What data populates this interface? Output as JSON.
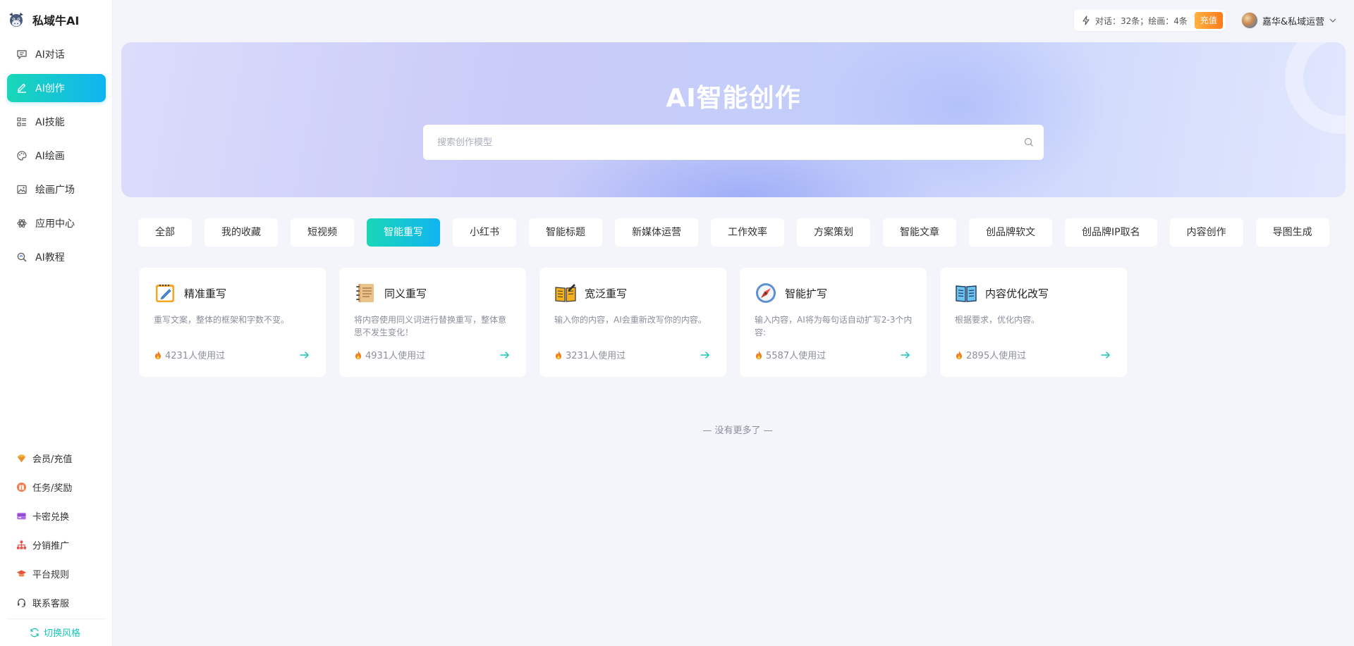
{
  "brand": {
    "name": "私域牛AI"
  },
  "nav": {
    "items": [
      {
        "label": "AI对话",
        "icon": "chat-icon"
      },
      {
        "label": "AI创作",
        "icon": "pen-icon",
        "active": true
      },
      {
        "label": "AI技能",
        "icon": "list-icon"
      },
      {
        "label": "AI绘画",
        "icon": "palette-icon"
      },
      {
        "label": "绘画广场",
        "icon": "image-icon"
      },
      {
        "label": "应用中心",
        "icon": "apps-icon"
      },
      {
        "label": "AI教程",
        "icon": "tutorial-icon"
      }
    ]
  },
  "bottom_nav": {
    "items": [
      {
        "label": "会员/充值",
        "icon": "diamond-icon"
      },
      {
        "label": "任务/奖励",
        "icon": "gift-icon"
      },
      {
        "label": "卡密兑换",
        "icon": "card-icon"
      },
      {
        "label": "分销推广",
        "icon": "network-icon"
      },
      {
        "label": "平台规则",
        "icon": "graduation-icon"
      },
      {
        "label": "联系客服",
        "icon": "headset-icon"
      }
    ],
    "switch_style": "切换风格"
  },
  "header": {
    "quota_text": "对话：32条；绘画：4条",
    "recharge_label": "充值",
    "user_name": "嘉华&私域运营"
  },
  "hero": {
    "title": "AI智能创作",
    "search_placeholder": "搜索创作模型"
  },
  "tabs": [
    {
      "label": "全部"
    },
    {
      "label": "我的收藏"
    },
    {
      "label": "短视频"
    },
    {
      "label": "智能重写",
      "active": true
    },
    {
      "label": "小红书"
    },
    {
      "label": "智能标题"
    },
    {
      "label": "新媒体运营"
    },
    {
      "label": "工作效率"
    },
    {
      "label": "方案策划"
    },
    {
      "label": "智能文章"
    },
    {
      "label": "创品牌软文"
    },
    {
      "label": "创品牌IP取名"
    },
    {
      "label": "内容创作"
    },
    {
      "label": "导图生成"
    }
  ],
  "cards": [
    {
      "title": "精准重写",
      "desc": "重写文案，整体的框架和字数不变。",
      "usage": "4231人使用过",
      "icon": "notepad-icon"
    },
    {
      "title": "同义重写",
      "desc": "将内容使用同义词进行替换重写，整体意思不发生变化！",
      "usage": "4931人使用过",
      "icon": "notebook-icon"
    },
    {
      "title": "宽泛重写",
      "desc": "输入你的内容，AI会重新改写你的内容。",
      "usage": "3231人使用过",
      "icon": "book-icon"
    },
    {
      "title": "智能扩写",
      "desc": "输入内容，AI将为每句话自动扩写2-3个内容:",
      "usage": "5587人使用过",
      "icon": "compass-icon"
    },
    {
      "title": "内容优化改写",
      "desc": "根据要求，优化内容。",
      "usage": "2895人使用过",
      "icon": "reading-icon"
    }
  ],
  "footer": {
    "no_more": "— 没有更多了 —"
  },
  "colors": {
    "accent_start": "#19d7b7",
    "accent_end": "#10b4f1",
    "recharge": "#ff8a24"
  }
}
